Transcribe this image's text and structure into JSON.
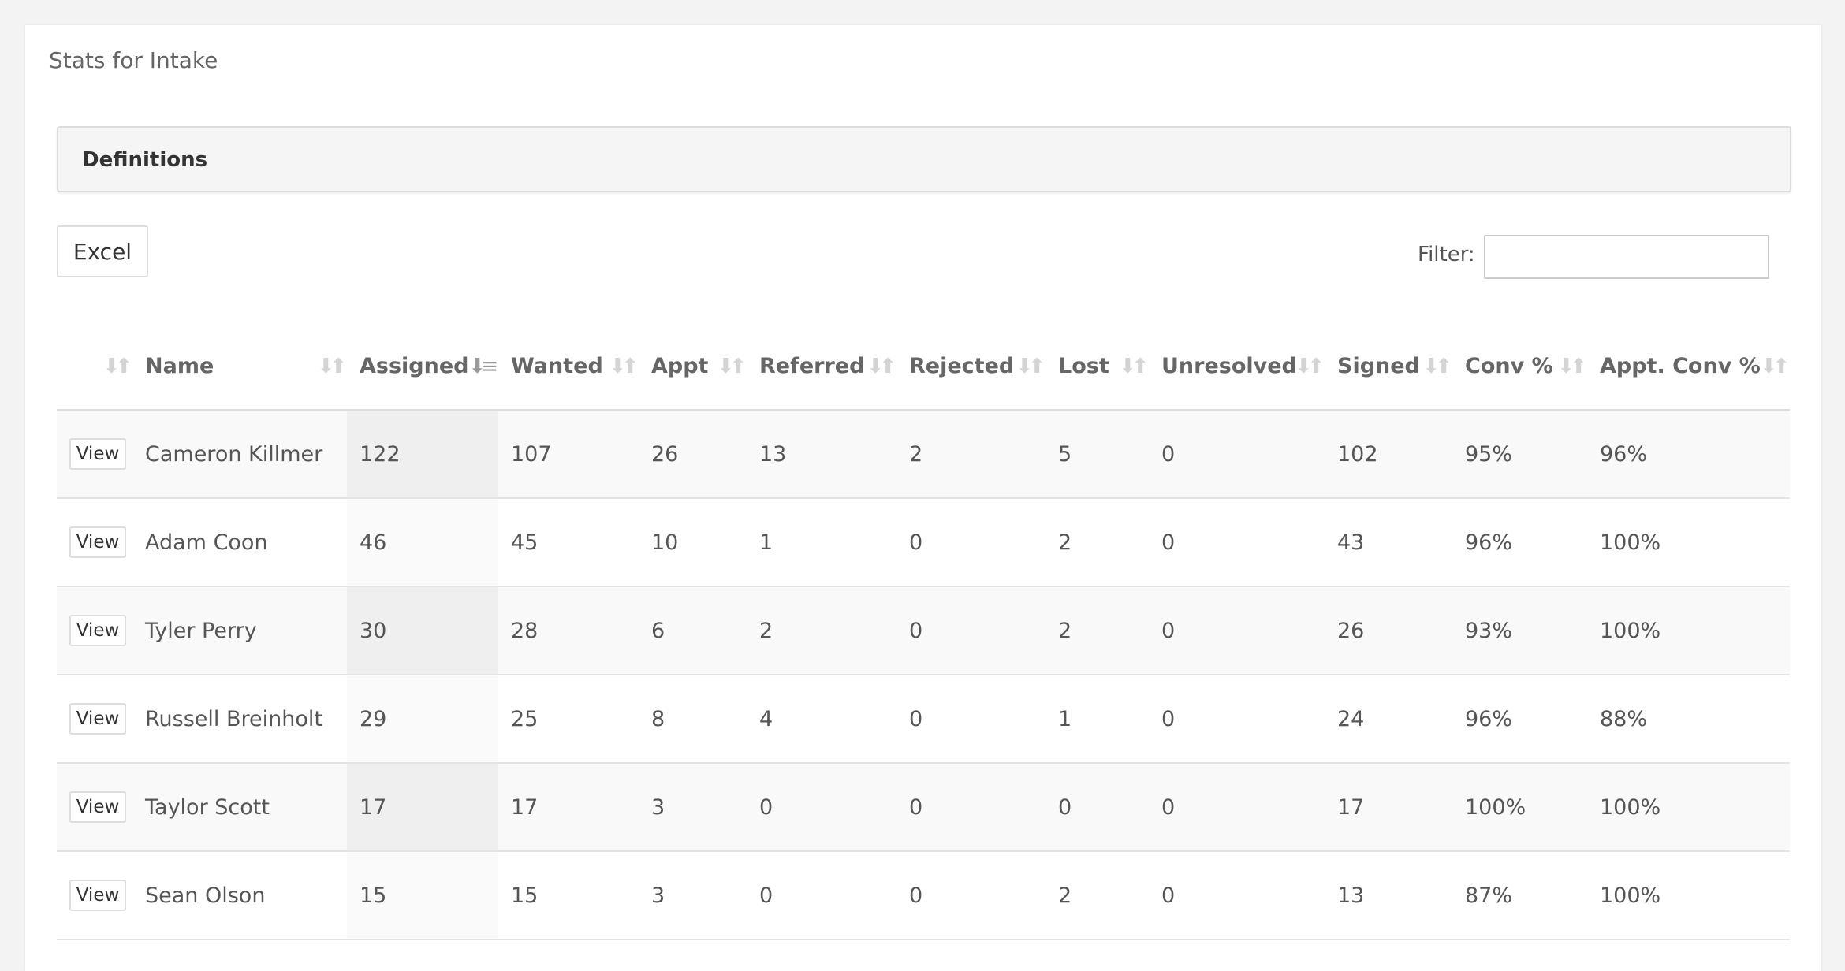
{
  "page": {
    "title": "Stats for Intake"
  },
  "definitions": {
    "label": "Definitions"
  },
  "toolbar": {
    "excel_label": "Excel",
    "filter_label": "Filter:",
    "filter_value": ""
  },
  "table": {
    "headers": [
      "",
      "Name",
      "Assigned",
      "Wanted",
      "Appt",
      "Referred",
      "Rejected",
      "Lost",
      "Unresolved",
      "Signed",
      "Conv %",
      "Appt. Conv %"
    ],
    "sort_icon": "sort-icon",
    "sorted_column": "Assigned",
    "view_label": "View",
    "rows": [
      [
        "Cameron Killmer",
        "122",
        "107",
        "26",
        "13",
        "2",
        "5",
        "0",
        "102",
        "95%",
        "96%"
      ],
      [
        "Adam Coon",
        "46",
        "45",
        "10",
        "1",
        "0",
        "2",
        "0",
        "43",
        "96%",
        "100%"
      ],
      [
        "Tyler Perry",
        "30",
        "28",
        "6",
        "2",
        "0",
        "2",
        "0",
        "26",
        "93%",
        "100%"
      ],
      [
        "Russell Breinholt",
        "29",
        "25",
        "8",
        "4",
        "0",
        "1",
        "0",
        "24",
        "96%",
        "88%"
      ],
      [
        "Taylor Scott",
        "17",
        "17",
        "3",
        "0",
        "0",
        "0",
        "0",
        "17",
        "100%",
        "100%"
      ],
      [
        "Sean Olson",
        "15",
        "15",
        "3",
        "0",
        "0",
        "2",
        "0",
        "13",
        "87%",
        "100%"
      ]
    ]
  }
}
